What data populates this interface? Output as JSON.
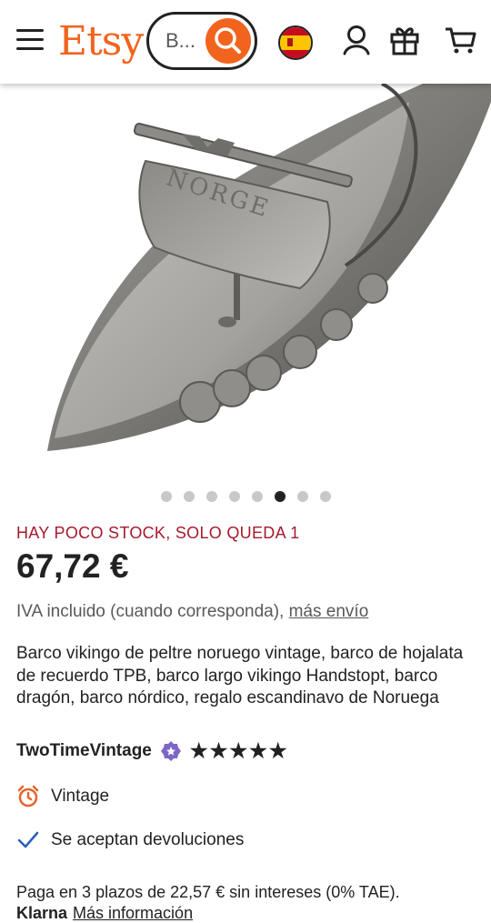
{
  "header": {
    "logo": "Etsy",
    "search_text": "B..."
  },
  "gallery": {
    "total_images": 8,
    "active_index": 5
  },
  "product": {
    "stock_notice": "HAY POCO STOCK, SOLO QUEDA 1",
    "price": "67,72 €",
    "vat_text": "IVA incluido (cuando corresponda), ",
    "shipping_link": "más envío",
    "title": "Barco vikingo de peltre noruego vintage, barco de hojalata de recuerdo TPB, barco largo vikingo Handstopt, barco dragón, barco nórdico, regalo escandinavo de Noruega",
    "shop_name": "TwoTimeVintage",
    "rating_stars": 5,
    "features": [
      {
        "icon": "alarm-clock-icon",
        "label": "Vintage"
      },
      {
        "icon": "checkmark-icon",
        "label": "Se aceptan devoluciones"
      }
    ],
    "installments": "Paga en 3 plazos de 22,57 € sin intereses (0% TAE).",
    "klarna_brand": "Klarna",
    "klarna_more": "Más información"
  },
  "colors": {
    "brand": "#f1641e",
    "stock": "#a61a2e",
    "badge": "#7f66c6",
    "check": "#2a5fb8",
    "alarm": "#e8632b"
  }
}
